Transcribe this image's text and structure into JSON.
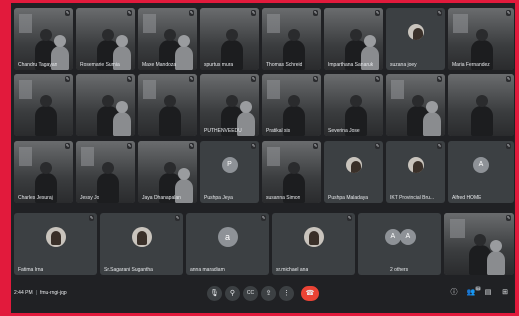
{
  "tiles_row1": [
    {
      "name": "Chandru Tagayan",
      "mic": "✎"
    },
    {
      "name": "Rosemarie Sumia",
      "mic": "✎"
    },
    {
      "name": "Maxe Mandoza",
      "mic": "✎"
    },
    {
      "name": "spurtus mura",
      "mic": "✎"
    },
    {
      "name": "Thomas Schreid",
      "mic": "✎"
    },
    {
      "name": "Imparthana Sanaruk",
      "mic": "✎"
    },
    {
      "name": "suzana joey",
      "mic": "✎"
    },
    {
      "name": "Maria Fernandez",
      "mic": "✎"
    }
  ],
  "tiles_row2": [
    {
      "name": "",
      "mic": "✎"
    },
    {
      "name": "",
      "mic": "✎"
    },
    {
      "name": "",
      "mic": "✎"
    },
    {
      "name": "PUTHENVEEDU",
      "mic": "✎"
    },
    {
      "name": "Pratikal sis",
      "mic": "✎"
    },
    {
      "name": "Severina Jose",
      "mic": "✎"
    },
    {
      "name": "",
      "mic": "✎"
    },
    {
      "name": "",
      "mic": "✎"
    }
  ],
  "tiles_row3": [
    {
      "name": "Charles Jesuraj",
      "mic": "✎"
    },
    {
      "name": "Jessy Jo",
      "mic": "✎"
    },
    {
      "name": "Jaya Dhanapalan",
      "mic": "✎"
    },
    {
      "name": "Pushpa Jeya",
      "mic": "✎",
      "initial": "P"
    },
    {
      "name": "susanna Simon",
      "mic": "✎"
    },
    {
      "name": "Pushpa Maladaya",
      "mic": "✎"
    },
    {
      "name": "IKT Provincial Bru...",
      "mic": "✎"
    },
    {
      "name": "Alfred HOME",
      "mic": "✎",
      "initial": "A"
    }
  ],
  "tiles_row4": [
    {
      "name": "Fatima Irna",
      "mic": "✎"
    },
    {
      "name": "Sr.Sagarani Sugantha",
      "mic": "✎"
    },
    {
      "name": "anna maradiam",
      "mic": "✎",
      "initial": "a"
    },
    {
      "name": "sr.michael ana",
      "mic": "✎"
    },
    {
      "name": "2 others",
      "mic": "",
      "initial": "A",
      "initial2": "A"
    },
    {
      "name": "",
      "mic": "✎"
    }
  ],
  "bottom": {
    "time": "2:44 PM",
    "separator": "|",
    "meeting_code": "fmu-rngi-jqp",
    "controls": {
      "mic": "🎙",
      "camera": "⚲",
      "captions": "CC",
      "present": "⇪",
      "more": "⋮",
      "hangup": "☎"
    },
    "side": {
      "info": "ⓘ",
      "people": "👥",
      "people_count": "54",
      "chat": "▤",
      "activities": "⊞"
    }
  },
  "colors": {
    "frame": "#e21a3c",
    "background": "#202124",
    "tile": "#3c4043",
    "hangup": "#ea4335"
  }
}
